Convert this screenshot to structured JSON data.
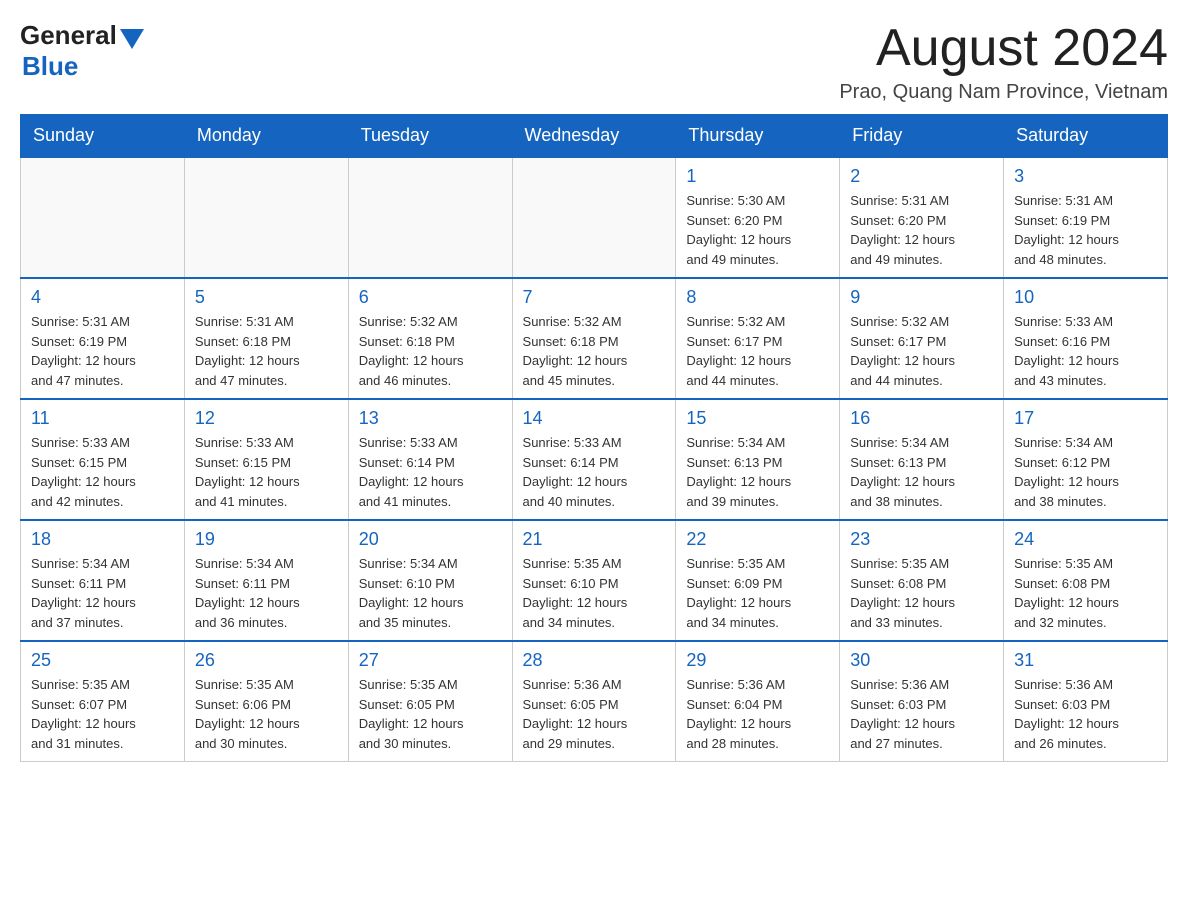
{
  "header": {
    "logo_general": "General",
    "logo_blue": "Blue",
    "title": "August 2024",
    "subtitle": "Prao, Quang Nam Province, Vietnam"
  },
  "calendar": {
    "columns": [
      "Sunday",
      "Monday",
      "Tuesday",
      "Wednesday",
      "Thursday",
      "Friday",
      "Saturday"
    ],
    "weeks": [
      {
        "days": [
          {
            "number": "",
            "info": ""
          },
          {
            "number": "",
            "info": ""
          },
          {
            "number": "",
            "info": ""
          },
          {
            "number": "",
            "info": ""
          },
          {
            "number": "1",
            "info": "Sunrise: 5:30 AM\nSunset: 6:20 PM\nDaylight: 12 hours\nand 49 minutes."
          },
          {
            "number": "2",
            "info": "Sunrise: 5:31 AM\nSunset: 6:20 PM\nDaylight: 12 hours\nand 49 minutes."
          },
          {
            "number": "3",
            "info": "Sunrise: 5:31 AM\nSunset: 6:19 PM\nDaylight: 12 hours\nand 48 minutes."
          }
        ]
      },
      {
        "days": [
          {
            "number": "4",
            "info": "Sunrise: 5:31 AM\nSunset: 6:19 PM\nDaylight: 12 hours\nand 47 minutes."
          },
          {
            "number": "5",
            "info": "Sunrise: 5:31 AM\nSunset: 6:18 PM\nDaylight: 12 hours\nand 47 minutes."
          },
          {
            "number": "6",
            "info": "Sunrise: 5:32 AM\nSunset: 6:18 PM\nDaylight: 12 hours\nand 46 minutes."
          },
          {
            "number": "7",
            "info": "Sunrise: 5:32 AM\nSunset: 6:18 PM\nDaylight: 12 hours\nand 45 minutes."
          },
          {
            "number": "8",
            "info": "Sunrise: 5:32 AM\nSunset: 6:17 PM\nDaylight: 12 hours\nand 44 minutes."
          },
          {
            "number": "9",
            "info": "Sunrise: 5:32 AM\nSunset: 6:17 PM\nDaylight: 12 hours\nand 44 minutes."
          },
          {
            "number": "10",
            "info": "Sunrise: 5:33 AM\nSunset: 6:16 PM\nDaylight: 12 hours\nand 43 minutes."
          }
        ]
      },
      {
        "days": [
          {
            "number": "11",
            "info": "Sunrise: 5:33 AM\nSunset: 6:15 PM\nDaylight: 12 hours\nand 42 minutes."
          },
          {
            "number": "12",
            "info": "Sunrise: 5:33 AM\nSunset: 6:15 PM\nDaylight: 12 hours\nand 41 minutes."
          },
          {
            "number": "13",
            "info": "Sunrise: 5:33 AM\nSunset: 6:14 PM\nDaylight: 12 hours\nand 41 minutes."
          },
          {
            "number": "14",
            "info": "Sunrise: 5:33 AM\nSunset: 6:14 PM\nDaylight: 12 hours\nand 40 minutes."
          },
          {
            "number": "15",
            "info": "Sunrise: 5:34 AM\nSunset: 6:13 PM\nDaylight: 12 hours\nand 39 minutes."
          },
          {
            "number": "16",
            "info": "Sunrise: 5:34 AM\nSunset: 6:13 PM\nDaylight: 12 hours\nand 38 minutes."
          },
          {
            "number": "17",
            "info": "Sunrise: 5:34 AM\nSunset: 6:12 PM\nDaylight: 12 hours\nand 38 minutes."
          }
        ]
      },
      {
        "days": [
          {
            "number": "18",
            "info": "Sunrise: 5:34 AM\nSunset: 6:11 PM\nDaylight: 12 hours\nand 37 minutes."
          },
          {
            "number": "19",
            "info": "Sunrise: 5:34 AM\nSunset: 6:11 PM\nDaylight: 12 hours\nand 36 minutes."
          },
          {
            "number": "20",
            "info": "Sunrise: 5:34 AM\nSunset: 6:10 PM\nDaylight: 12 hours\nand 35 minutes."
          },
          {
            "number": "21",
            "info": "Sunrise: 5:35 AM\nSunset: 6:10 PM\nDaylight: 12 hours\nand 34 minutes."
          },
          {
            "number": "22",
            "info": "Sunrise: 5:35 AM\nSunset: 6:09 PM\nDaylight: 12 hours\nand 34 minutes."
          },
          {
            "number": "23",
            "info": "Sunrise: 5:35 AM\nSunset: 6:08 PM\nDaylight: 12 hours\nand 33 minutes."
          },
          {
            "number": "24",
            "info": "Sunrise: 5:35 AM\nSunset: 6:08 PM\nDaylight: 12 hours\nand 32 minutes."
          }
        ]
      },
      {
        "days": [
          {
            "number": "25",
            "info": "Sunrise: 5:35 AM\nSunset: 6:07 PM\nDaylight: 12 hours\nand 31 minutes."
          },
          {
            "number": "26",
            "info": "Sunrise: 5:35 AM\nSunset: 6:06 PM\nDaylight: 12 hours\nand 30 minutes."
          },
          {
            "number": "27",
            "info": "Sunrise: 5:35 AM\nSunset: 6:05 PM\nDaylight: 12 hours\nand 30 minutes."
          },
          {
            "number": "28",
            "info": "Sunrise: 5:36 AM\nSunset: 6:05 PM\nDaylight: 12 hours\nand 29 minutes."
          },
          {
            "number": "29",
            "info": "Sunrise: 5:36 AM\nSunset: 6:04 PM\nDaylight: 12 hours\nand 28 minutes."
          },
          {
            "number": "30",
            "info": "Sunrise: 5:36 AM\nSunset: 6:03 PM\nDaylight: 12 hours\nand 27 minutes."
          },
          {
            "number": "31",
            "info": "Sunrise: 5:36 AM\nSunset: 6:03 PM\nDaylight: 12 hours\nand 26 minutes."
          }
        ]
      }
    ]
  }
}
